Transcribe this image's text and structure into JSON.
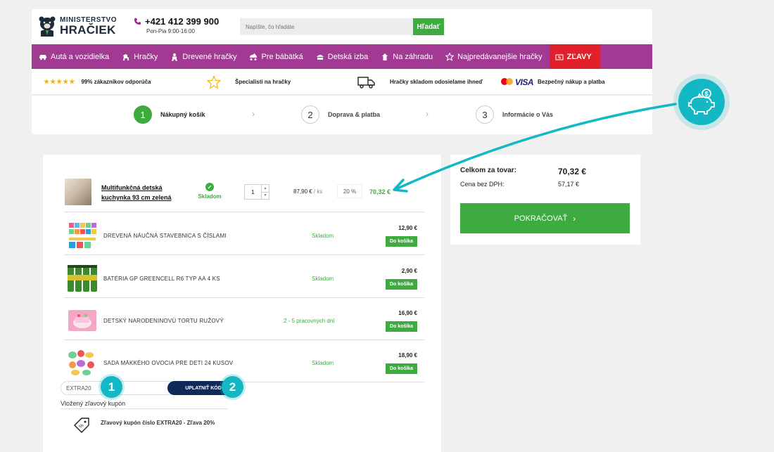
{
  "header": {
    "logo_small": "MINISTERSTVO",
    "logo_big": "HRAČIEK",
    "phone": "+421 412 399 900",
    "hours": "Pon-Pia 9:00-16:00",
    "search_placeholder": "Napíšte, čo hľadáte",
    "search_button": "Hľadať"
  },
  "nav": {
    "items": [
      {
        "label": "Autá a vozidielka",
        "icon": "car-icon"
      },
      {
        "label": "Hračky",
        "icon": "horse-icon"
      },
      {
        "label": "Drevené hračky",
        "icon": "wooden-toy-icon"
      },
      {
        "label": "Pre bábätká",
        "icon": "baby-icon"
      },
      {
        "label": "Detská izba",
        "icon": "room-icon"
      },
      {
        "label": "Na záhradu",
        "icon": "garden-icon"
      },
      {
        "label": "Najpredávanejšie hračky",
        "icon": "bestseller-icon"
      }
    ],
    "sale": "ZĽAVY",
    "sale_color": "#e0212b",
    "nav_color": "#a23a93"
  },
  "benefits": {
    "recommend": "99% zákazníkov odporúča",
    "specialists": "Špecialisti na hračky",
    "shipping": "Hračky skladom odosielame ihneď",
    "secure": "Bezpečný nákup a platba",
    "visa": "VISA"
  },
  "steps": [
    {
      "num": "1",
      "label": "Nákupný košík"
    },
    {
      "num": "2",
      "label": "Doprava & platba"
    },
    {
      "num": "3",
      "label": "Informácie o Vás"
    }
  ],
  "cart": {
    "main": {
      "title": "Multifunkčná detská kuchynka 93 cm zelená",
      "stock": "Skladom",
      "qty": "1",
      "unit_price": "87,90 €",
      "unit": " / ks",
      "vat": "20 %",
      "total": "70,32 €"
    },
    "recommended": [
      {
        "name": "DREVENÁ NÁUČNÁ STAVEBNICA S ČÍSLAMI",
        "stock": "Skladom",
        "price": "12,90 €",
        "button": "Do košíka"
      },
      {
        "name": "BATÉRIA GP GREENCELL R6 TYP AA 4 KS",
        "stock": "Skladom",
        "price": "2,90 €",
        "button": "Do košíka"
      },
      {
        "name": "DETSKÝ NARODENINOVÚ TORTU RUŽOVÝ",
        "stock": "2 - 5 pracovných dní",
        "price": "16,90 €",
        "button": "Do košíka"
      },
      {
        "name": "SADA MÄKKÉHO OVOCIA PRE DETI 24 KUSOV",
        "stock": "Skladom",
        "price": "18,90 €",
        "button": "Do košíka"
      }
    ],
    "coupon_value": "EXTRA20",
    "coupon_button": "UPLATNIŤ KÓD",
    "coupon_label": "Vložený zľavový kupón",
    "coupon_desc": "Zľavový kupón číslo EXTRA20 - Zľava 20%",
    "badge1": "1",
    "badge2": "2"
  },
  "summary": {
    "total_label": "Celkom za tovar:",
    "total_value": "70,32 €",
    "novat_label": "Cena bez DPH:",
    "novat_value": "57,17 €",
    "continue": "POKRAČOVAŤ"
  },
  "colors": {
    "green": "#3dab3f",
    "teal": "#14b8c4",
    "navy": "#0f2a5a"
  }
}
